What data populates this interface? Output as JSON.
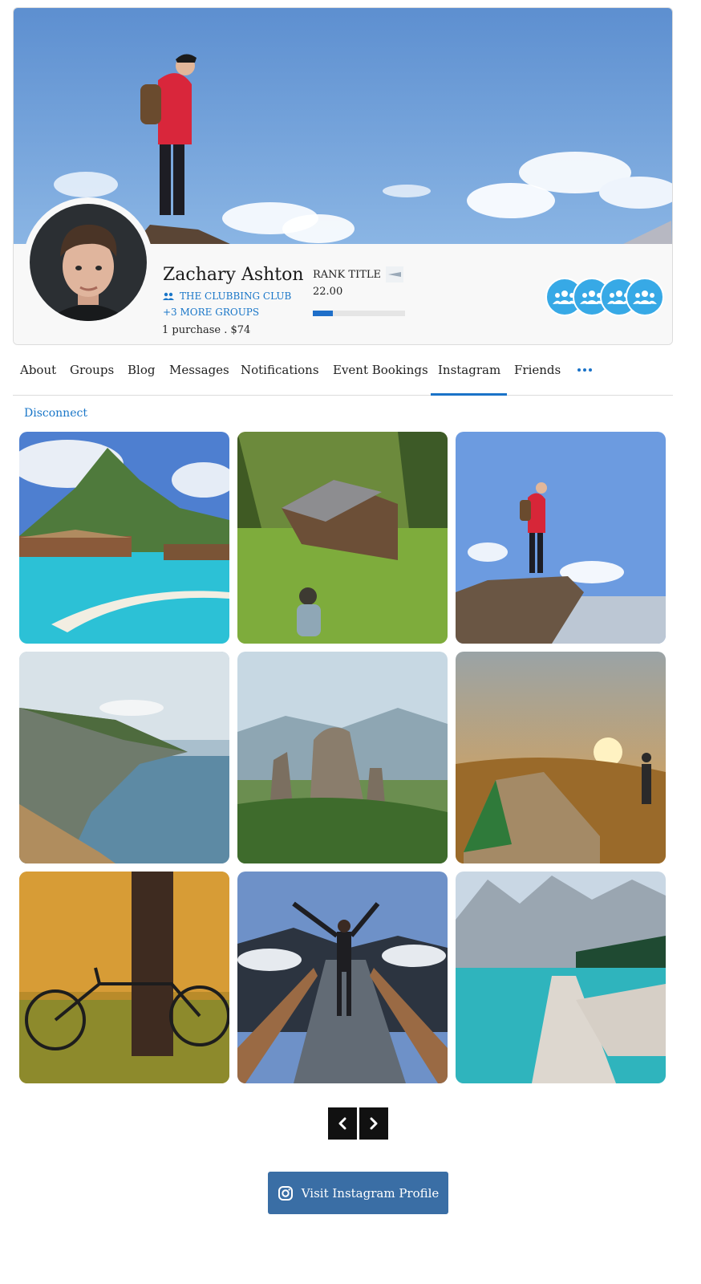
{
  "profile": {
    "name": "Zachary Ashton",
    "group_name": "THE CLUBBING CLUB",
    "more_groups": "+3 MORE GROUPS",
    "purchases": "1 purchase . $74",
    "rank_title": "RANK TITLE",
    "rank_value": "22.00",
    "rank_progress": 0.22,
    "badge_count": 4
  },
  "tabs": [
    {
      "label": "About"
    },
    {
      "label": "Groups"
    },
    {
      "label": "Blog"
    },
    {
      "label": "Messages"
    },
    {
      "label": "Notifications"
    },
    {
      "label": "Event Bookings"
    },
    {
      "label": "Instagram",
      "active": true
    },
    {
      "label": "Friends"
    }
  ],
  "instagram": {
    "disconnect_label": "Disconnect",
    "photos": [
      {
        "subject": "tropical overwater bungalows"
      },
      {
        "subject": "wooden cabin in forest meadow"
      },
      {
        "subject": "hiker standing on rock"
      },
      {
        "subject": "coastal cliffs and sea"
      },
      {
        "subject": "rock pillars in valley"
      },
      {
        "subject": "tent at sunset"
      },
      {
        "subject": "bicycle against tree"
      },
      {
        "subject": "person on mountain walkway"
      },
      {
        "subject": "turquoise mountain lake with log"
      }
    ],
    "prev_label": "‹",
    "next_label": "›",
    "visit_label": "Visit Instagram Profile"
  },
  "colors": {
    "accent": "#1976c8",
    "badge": "#37a9e6",
    "visit_button": "#3a6ea5"
  }
}
